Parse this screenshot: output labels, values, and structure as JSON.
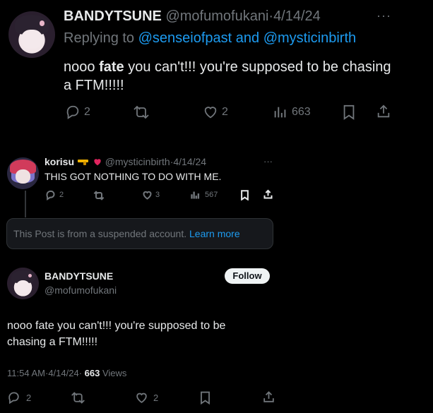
{
  "tweet1": {
    "display_name": "BANDYTSUNE",
    "handle": "@mofumofukani",
    "separator": "·",
    "date": "4/14/24",
    "more": "···",
    "replying_to_prefix": "Replying to",
    "reply_users": "@senseiofpast and @mysticinbirth",
    "text_before": "nooo ",
    "text_bold": "fate",
    "text_after": " you can't!!! you're supposed to be chasing a FTM!!!!!",
    "stats": {
      "replies": "2",
      "likes": "2",
      "views": "663"
    }
  },
  "tweet2": {
    "display_name": "korisu",
    "handle": "@mysticinbirth",
    "separator": "·",
    "date": "4/14/24",
    "more": "···",
    "text": "THIS GOT NOTHING TO DO WITH ME.",
    "stats": {
      "replies": "2",
      "likes": "3",
      "views": "567"
    }
  },
  "suspended": {
    "text": "This Post is from a suspended account.",
    "link": "Learn more"
  },
  "main_tweet": {
    "display_name": "BANDYTSUNE",
    "handle": "@mofumofukani",
    "follow_label": "Follow",
    "text": "nooo fate you can't!!! you're supposed to be chasing a FTM!!!!!",
    "time": "11:54 AM",
    "separator": "·",
    "date": "4/14/24",
    "view_count": "663",
    "views_label": "Views",
    "stats": {
      "replies": "2",
      "likes": "2"
    }
  },
  "colors": {
    "accent": "#1d9bf0",
    "muted": "#71767b",
    "background": "#000000",
    "text": "#e7e9ea"
  },
  "icons": [
    "reply-icon",
    "retweet-icon",
    "like-icon",
    "views-icon",
    "bookmark-icon",
    "share-icon",
    "more-icon",
    "verified-heart-icon",
    "pistol-emoji-icon"
  ]
}
